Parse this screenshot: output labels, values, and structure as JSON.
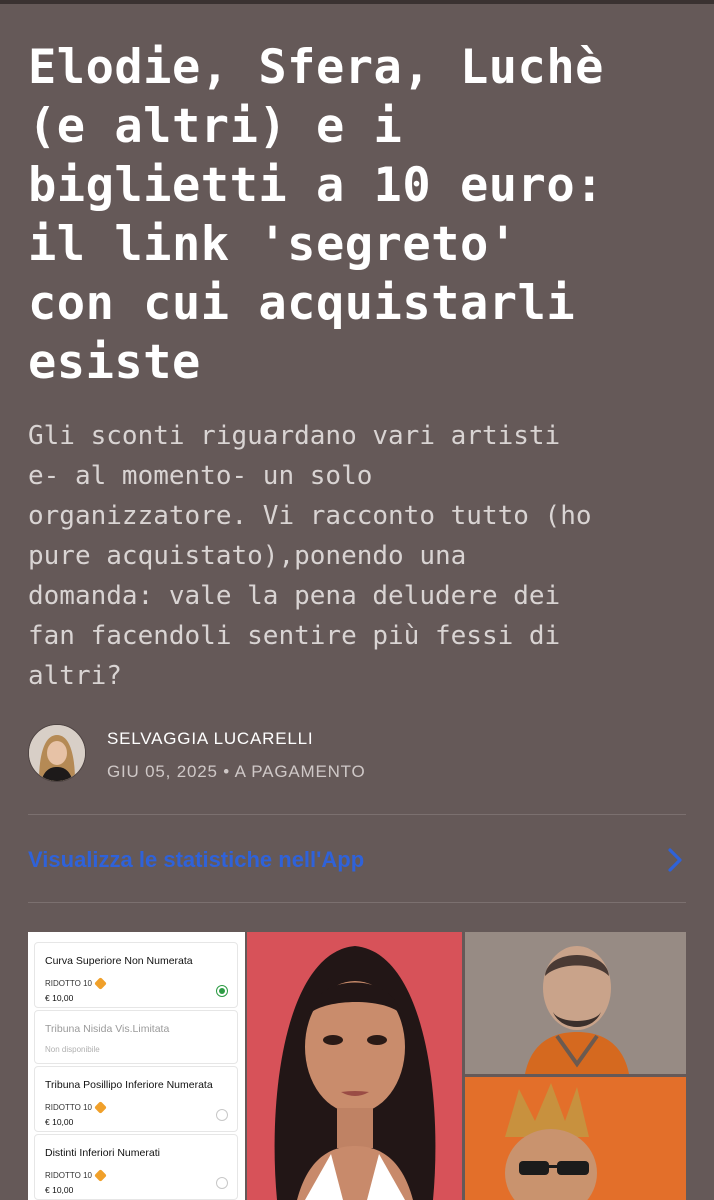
{
  "article": {
    "title": "Elodie, Sfera, Luchè\n(e altri) e i\nbiglietti a 10 euro:\nil link 'segreto'\ncon cui acquistarli\nesiste",
    "subtitle": "Gli sconti riguardano vari artisti\ne- al momento- un solo\norganizzatore. Vi racconto tutto (ho\npure acquistato),ponendo una\ndomanda: vale la pena deludere dei\nfan facendoli sentire più fessi di\naltri?"
  },
  "author": {
    "name": "SELVAGGIA LUCARELLI",
    "meta": "GIU 05, 2025 • A PAGAMENTO"
  },
  "stats": {
    "label": "Visualizza le statistiche nell'App"
  },
  "tickets": [
    {
      "title": "Curva Superiore Non Numerata",
      "tag": "RIDOTTO 10",
      "price": "€ 10,00",
      "selected": true
    },
    {
      "title": "Tribuna Nisida Vis.Limitata",
      "status": "Non disponibile"
    },
    {
      "title": "Tribuna Posillipo Inferiore Numerata",
      "tag": "RIDOTTO 10",
      "price": "€ 10,00",
      "selected": false
    },
    {
      "title": "Distinti Inferiori Numerati",
      "tag": "RIDOTTO 10",
      "price": "€ 10,00",
      "selected": false
    }
  ],
  "colors": {
    "background": "#655958",
    "link": "#2f62d9",
    "selected_radio": "#2d9b44",
    "tag": "#f0a02a"
  }
}
